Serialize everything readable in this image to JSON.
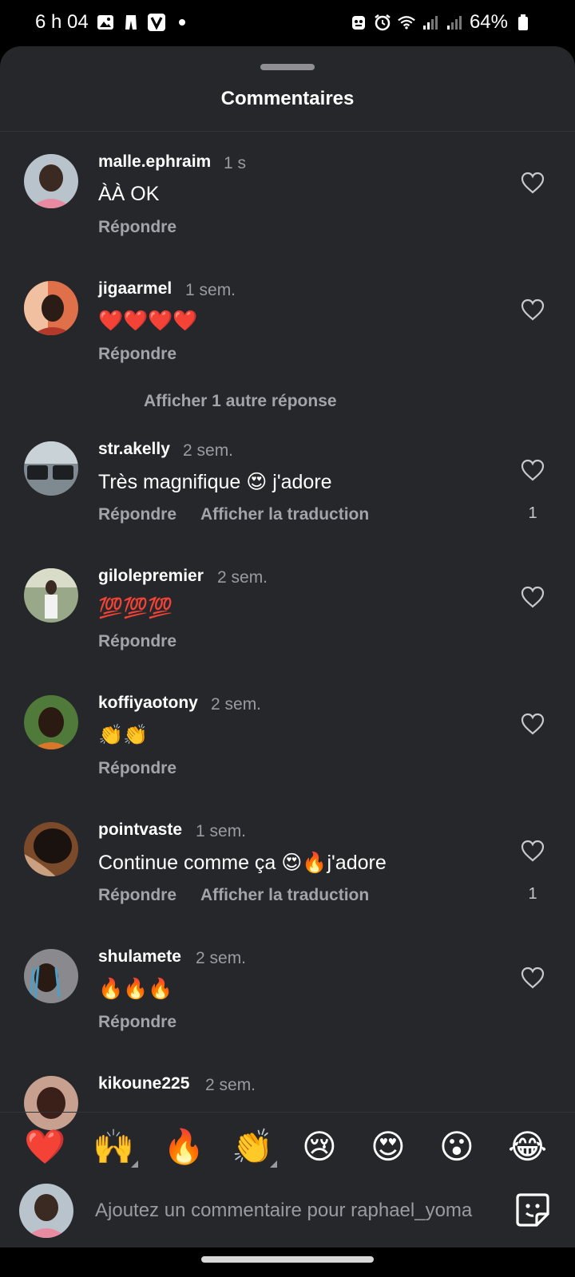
{
  "status_bar": {
    "time": "6 h 04",
    "battery": "64%",
    "icons": [
      "gallery-icon",
      "pants-icon",
      "app-v-icon",
      "dot-icon",
      "robot-icon",
      "alarm-icon",
      "wifi-icon",
      "signal-icon",
      "signal-icon",
      "battery-icon"
    ]
  },
  "sheet": {
    "title": "Commentaires"
  },
  "comments": [
    {
      "username": "malle.ephraim",
      "time": "1 s",
      "text": "ÀÀ OK",
      "reply": "Répondre",
      "likes": "",
      "translate": ""
    },
    {
      "username": "jigaarmel",
      "time": "1 sem.",
      "text": "❤️❤️❤️❤️",
      "reply": "Répondre",
      "likes": "",
      "translate": ""
    },
    {
      "username": "str.akelly",
      "time": "2 sem.",
      "text": "Très magnifique 😍 j'adore",
      "reply": "Répondre",
      "likes": "1",
      "translate": "Afficher la traduction"
    },
    {
      "username": "gilolepremier",
      "time": "2 sem.",
      "text": "💯💯💯",
      "reply": "Répondre",
      "likes": "",
      "translate": ""
    },
    {
      "username": "koffiyaotony",
      "time": "2 sem.",
      "text": "👏👏",
      "reply": "Répondre",
      "likes": "",
      "translate": ""
    },
    {
      "username": "pointvaste",
      "time": "1 sem.",
      "text": "Continue comme ça 😍🔥j'adore",
      "reply": "Répondre",
      "likes": "1",
      "translate": "Afficher la traduction"
    },
    {
      "username": "shulamete",
      "time": "2 sem.",
      "text": "🔥🔥🔥",
      "reply": "Répondre",
      "likes": "",
      "translate": ""
    },
    {
      "username": "kikoune225",
      "time": "2 sem.",
      "text": "",
      "reply": "",
      "likes": "",
      "translate": ""
    }
  ],
  "more_replies": "Afficher 1 autre réponse",
  "quick_reactions": [
    "❤️",
    "🙌",
    "🔥",
    "👏",
    "😢",
    "😍",
    "😮",
    "😂"
  ],
  "composer": {
    "placeholder": "Ajoutez un commentaire pour raphael_yoma"
  },
  "colors": {
    "sheet_bg": "#26272b",
    "secondary_text": "#a3a4a9",
    "background": "#000000"
  }
}
